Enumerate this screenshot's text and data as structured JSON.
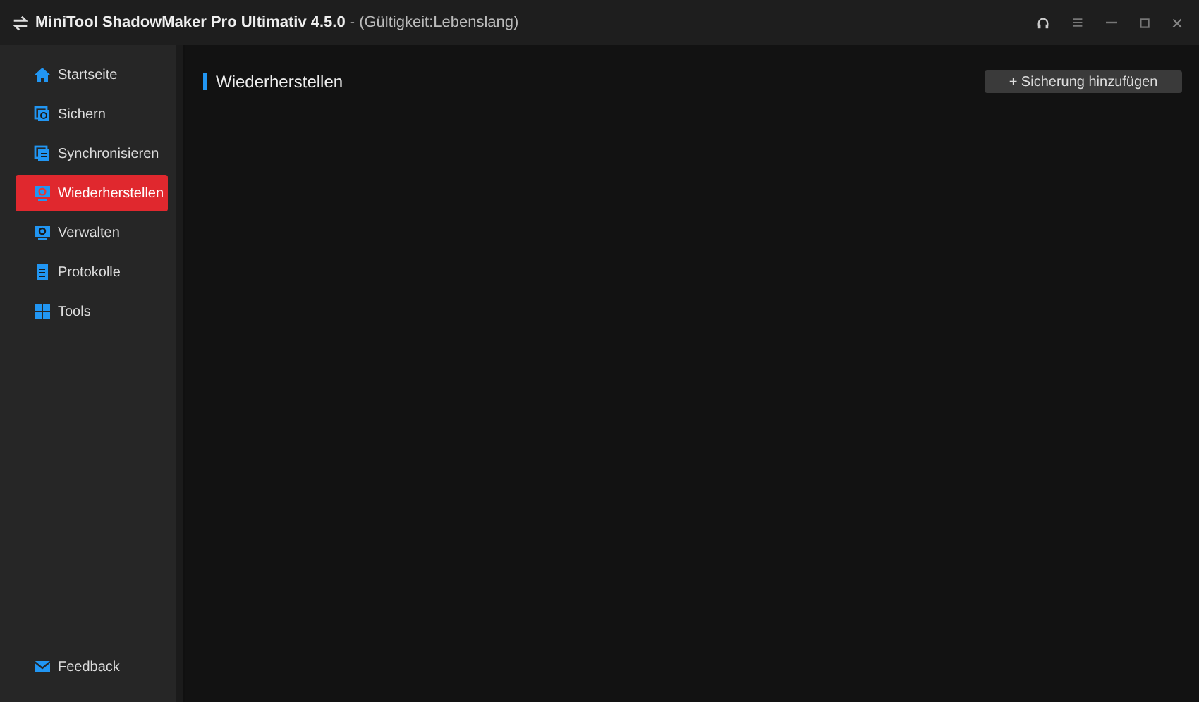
{
  "window": {
    "title": "MiniTool ShadowMaker Pro Ultimativ 4.5.0",
    "subtitle": "- (Gültigkeit:Lebenslang)"
  },
  "sidebar": {
    "items": [
      {
        "label": "Startseite",
        "kind": "home",
        "selected": false
      },
      {
        "label": "Sichern",
        "kind": "backup",
        "selected": false
      },
      {
        "label": "Synchronisieren",
        "kind": "sync",
        "selected": false
      },
      {
        "label": "Wiederherstellen",
        "kind": "restore",
        "selected": true
      },
      {
        "label": "Verwalten",
        "kind": "manage",
        "selected": false
      },
      {
        "label": "Protokolle",
        "kind": "log",
        "selected": false
      },
      {
        "label": "Tools",
        "kind": "tools",
        "selected": false
      }
    ],
    "footer": {
      "label": "Feedback",
      "kind": "mail"
    }
  },
  "main": {
    "heading": "Wiederherstellen",
    "button": "+ Sicherung hinzufügen"
  }
}
